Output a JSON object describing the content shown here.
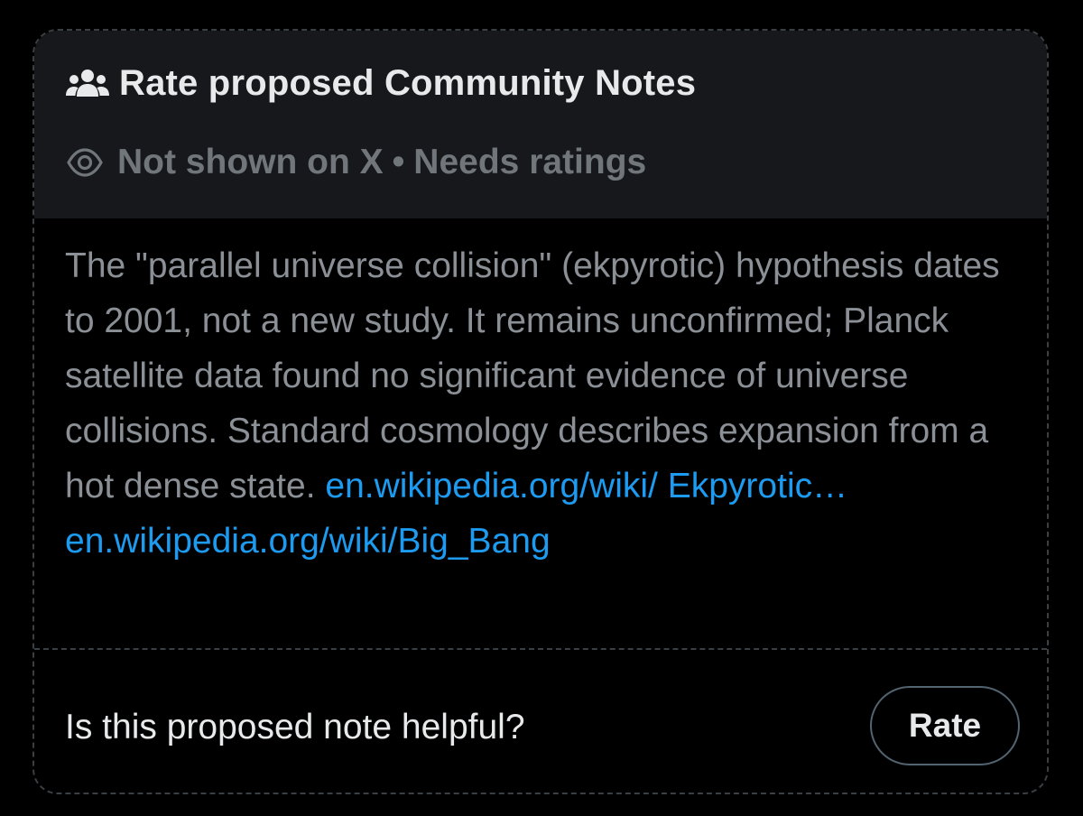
{
  "header": {
    "title": "Rate proposed Community Notes",
    "title_icon": "people-group-icon",
    "status_icon": "eye-icon",
    "status_left": "Not shown on X",
    "status_separator": "•",
    "status_right": "Needs ratings"
  },
  "note": {
    "text": "The \"parallel universe collision\" (ekpyrotic) hypothesis dates to 2001, not a new study. It remains unconfirmed; Planck satellite data found no significant evidence of universe collisions. Standard cosmology describes expansion from a hot dense state.",
    "link1_text": "en.wikipedia.org/wiki/ Ekpyrotic…",
    "link2_text": "en.wikipedia.org/wiki/Big_Bang"
  },
  "footer": {
    "question": "Is this proposed note helpful?",
    "rate_label": "Rate"
  },
  "colors": {
    "background": "#000000",
    "header_bg": "#16181c",
    "muted": "#71767b",
    "link": "#1d9bf0",
    "text": "#e7e9ea"
  }
}
